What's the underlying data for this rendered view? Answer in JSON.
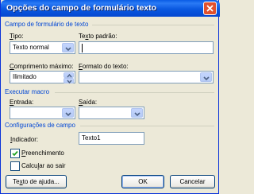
{
  "dialog": {
    "title": "Opções do campo de formulário texto",
    "close_icon": "close-icon"
  },
  "group_field": {
    "label": "Campo de formulário de texto",
    "tipo_label_u": "T",
    "tipo_label_rest": "ipo:",
    "tipo_value": "Texto normal",
    "texto_padrao_label_a": "Te",
    "texto_padrao_label_u": "x",
    "texto_padrao_label_b": "to padrão:",
    "texto_padrao_value": "",
    "comprimento_label_u": "C",
    "comprimento_label_rest": "omprimento máximo:",
    "comprimento_value": "Ilimitado",
    "formato_label_u": "F",
    "formato_label_rest": "ormato do texto:",
    "formato_value": ""
  },
  "group_macro": {
    "label": "Executar macro",
    "entrada_label_u": "E",
    "entrada_label_rest": "ntrada:",
    "entrada_value": "",
    "saida_label_u": "S",
    "saida_label_rest": "aída:",
    "saida_value": ""
  },
  "group_config": {
    "label": "Configurações de campo",
    "indicador_label_u": "I",
    "indicador_label_rest": "ndicador:",
    "indicador_value": "Texto1",
    "preenchimento_label_u": "P",
    "preenchimento_label_rest": "reenchimento",
    "preenchimento_checked": true,
    "calcular_label_a": "Calcu",
    "calcular_label_u": "l",
    "calcular_label_b": "ar ao sair",
    "calcular_checked": false
  },
  "buttons": {
    "help_a": "Te",
    "help_u": "x",
    "help_b": "to de ajuda...",
    "ok": "OK",
    "cancel": "Cancelar"
  },
  "colors": {
    "title_bar": "#0a5ce5",
    "group_label": "#0046d5",
    "close_button": "#e0512e"
  }
}
